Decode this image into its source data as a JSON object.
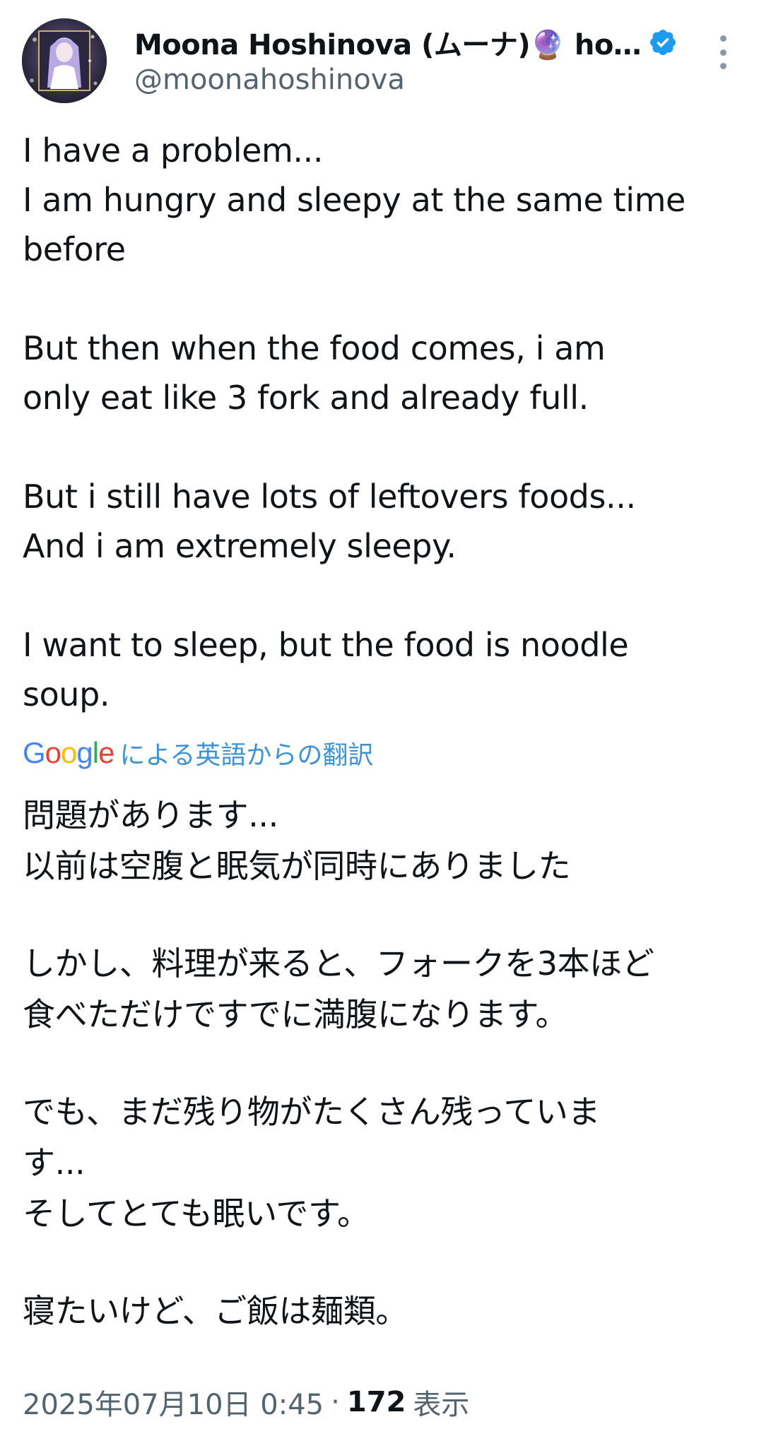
{
  "author": {
    "display_name": "Moona Hoshinova (ムーナ)🔮 ho…",
    "handle": "@moonahoshinova",
    "verified": true,
    "avatar": "avatar-image"
  },
  "tweet": {
    "paragraphs": [
      [
        "I have a problem...",
        "I am hungry and sleepy at the same time",
        "before"
      ],
      [
        "But then when the food comes, i am",
        "only eat like 3 fork and already full."
      ],
      [
        "But i still have lots of leftovers foods...",
        "And i am extremely sleepy."
      ],
      [
        "I want to sleep, but the food is noodle",
        "soup."
      ]
    ]
  },
  "translation": {
    "provider": "Google",
    "label": "による英語からの翻訳",
    "paragraphs": [
      [
        "問題があります...",
        "以前は空腹と眠気が同時にありました"
      ],
      [
        "しかし、料理が来ると、フォークを3本ほど",
        "食べただけですでに満腹になります。"
      ],
      [
        "でも、まだ残り物がたくさん残っていま",
        "す...",
        "そしてとても眠いです。"
      ],
      [
        "寝たいけど、ご飯は麺類。"
      ]
    ]
  },
  "meta": {
    "timestamp": "2025年07月10日 0:45",
    "separator": "·",
    "views_count": "172",
    "views_label": "表示"
  },
  "colors": {
    "text": "#0f1419",
    "secondary": "#536471",
    "link": "#1d9bf0",
    "verified": "#1d9bf0"
  },
  "icons": {
    "verified": "verified-badge-icon",
    "more": "more-vertical-icon"
  }
}
